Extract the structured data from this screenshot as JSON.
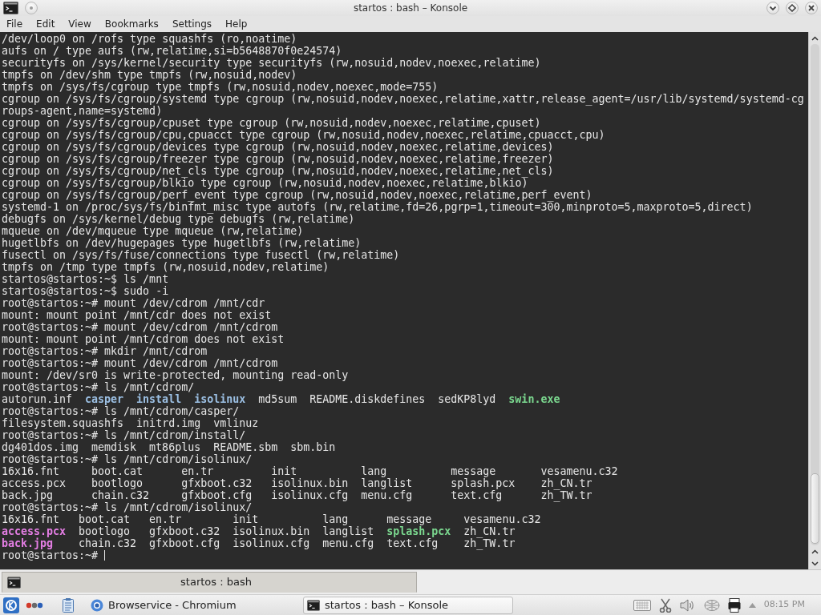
{
  "window": {
    "title": "startos : bash – Konsole"
  },
  "menu": [
    "File",
    "Edit",
    "View",
    "Bookmarks",
    "Settings",
    "Help"
  ],
  "terminal": {
    "lines": [
      {
        "kind": "text",
        "text": "/dev/loop0 on /rofs type squashfs (ro,noatime)"
      },
      {
        "kind": "text",
        "text": "aufs on / type aufs (rw,relatime,si=b5648870f0e24574)"
      },
      {
        "kind": "text",
        "text": "securityfs on /sys/kernel/security type securityfs (rw,nosuid,nodev,noexec,relatime)"
      },
      {
        "kind": "text",
        "text": "tmpfs on /dev/shm type tmpfs (rw,nosuid,nodev)"
      },
      {
        "kind": "text",
        "text": "tmpfs on /sys/fs/cgroup type tmpfs (rw,nosuid,nodev,noexec,mode=755)"
      },
      {
        "kind": "text",
        "text": "cgroup on /sys/fs/cgroup/systemd type cgroup (rw,nosuid,nodev,noexec,relatime,xattr,release_agent=/usr/lib/systemd/systemd-cg"
      },
      {
        "kind": "text",
        "text": "roups-agent,name=systemd)"
      },
      {
        "kind": "text",
        "text": "cgroup on /sys/fs/cgroup/cpuset type cgroup (rw,nosuid,nodev,noexec,relatime,cpuset)"
      },
      {
        "kind": "text",
        "text": "cgroup on /sys/fs/cgroup/cpu,cpuacct type cgroup (rw,nosuid,nodev,noexec,relatime,cpuacct,cpu)"
      },
      {
        "kind": "text",
        "text": "cgroup on /sys/fs/cgroup/devices type cgroup (rw,nosuid,nodev,noexec,relatime,devices)"
      },
      {
        "kind": "text",
        "text": "cgroup on /sys/fs/cgroup/freezer type cgroup (rw,nosuid,nodev,noexec,relatime,freezer)"
      },
      {
        "kind": "text",
        "text": "cgroup on /sys/fs/cgroup/net_cls type cgroup (rw,nosuid,nodev,noexec,relatime,net_cls)"
      },
      {
        "kind": "text",
        "text": "cgroup on /sys/fs/cgroup/blkio type cgroup (rw,nosuid,nodev,noexec,relatime,blkio)"
      },
      {
        "kind": "text",
        "text": "cgroup on /sys/fs/cgroup/perf_event type cgroup (rw,nosuid,nodev,noexec,relatime,perf_event)"
      },
      {
        "kind": "text",
        "text": "systemd-1 on /proc/sys/fs/binfmt_misc type autofs (rw,relatime,fd=26,pgrp=1,timeout=300,minproto=5,maxproto=5,direct)"
      },
      {
        "kind": "text",
        "text": "debugfs on /sys/kernel/debug type debugfs (rw,relatime)"
      },
      {
        "kind": "text",
        "text": "mqueue on /dev/mqueue type mqueue (rw,relatime)"
      },
      {
        "kind": "text",
        "text": "hugetlbfs on /dev/hugepages type hugetlbfs (rw,relatime)"
      },
      {
        "kind": "text",
        "text": "fusectl on /sys/fs/fuse/connections type fusectl (rw,relatime)"
      },
      {
        "kind": "text",
        "text": "tmpfs on /tmp type tmpfs (rw,nosuid,nodev,relatime)"
      },
      {
        "kind": "text",
        "text": "startos@startos:~$ ls /mnt"
      },
      {
        "kind": "text",
        "text": "startos@startos:~$ sudo -i"
      },
      {
        "kind": "text",
        "text": "root@startos:~# mount /dev/cdrom /mnt/cdr"
      },
      {
        "kind": "text",
        "text": "mount: mount point /mnt/cdr does not exist"
      },
      {
        "kind": "text",
        "text": "root@startos:~# mount /dev/cdrom /mnt/cdrom"
      },
      {
        "kind": "text",
        "text": "mount: mount point /mnt/cdrom does not exist"
      },
      {
        "kind": "text",
        "text": "root@startos:~# mkdir /mnt/cdrom"
      },
      {
        "kind": "text",
        "text": "root@startos:~# mount /dev/cdrom /mnt/cdrom"
      },
      {
        "kind": "text",
        "text": "mount: /dev/sr0 is write-protected, mounting read-only"
      },
      {
        "kind": "text",
        "text": "root@startos:~# ls /mnt/cdrom/"
      },
      {
        "kind": "listing",
        "rows": [
          [
            {
              "name": "autorun.inf",
              "color": "#e6e6e6",
              "bold": false
            },
            {
              "name": "casper",
              "color": "#9cc0e4",
              "bold": true
            },
            {
              "name": "install",
              "color": "#9cc0e4",
              "bold": true
            },
            {
              "name": "isolinux",
              "color": "#9cc0e4",
              "bold": true
            },
            {
              "name": "md5sum",
              "color": "#e6e6e6",
              "bold": false
            },
            {
              "name": "README.diskdefines",
              "color": "#e6e6e6",
              "bold": false
            },
            {
              "name": "sedKP8lyd",
              "color": "#e6e6e6",
              "bold": false
            },
            {
              "name": "swin.exe",
              "color": "#7bd88f",
              "bold": true
            }
          ]
        ]
      },
      {
        "kind": "text",
        "text": "root@startos:~# ls /mnt/cdrom/casper/"
      },
      {
        "kind": "listing",
        "rows": [
          [
            {
              "name": "filesystem.squashfs",
              "color": "#e6e6e6",
              "bold": false
            },
            {
              "name": "initrd.img",
              "color": "#e6e6e6",
              "bold": false
            },
            {
              "name": "vmlinuz",
              "color": "#e6e6e6",
              "bold": false
            }
          ]
        ]
      },
      {
        "kind": "text",
        "text": "root@startos:~# ls /mnt/cdrom/install/"
      },
      {
        "kind": "listing",
        "rows": [
          [
            {
              "name": "dg401dos.img",
              "color": "#e6e6e6",
              "bold": false
            },
            {
              "name": "memdisk",
              "color": "#e6e6e6",
              "bold": false
            },
            {
              "name": "mt86plus",
              "color": "#e6e6e6",
              "bold": false
            },
            {
              "name": "README.sbm",
              "color": "#e6e6e6",
              "bold": false
            },
            {
              "name": "sbm.bin",
              "color": "#e6e6e6",
              "bold": false
            }
          ]
        ]
      },
      {
        "kind": "text",
        "text": "root@startos:~# ls /mnt/cdrom/isolinux/"
      },
      {
        "kind": "columns",
        "rows": [
          [
            {
              "name": "16x16.fnt",
              "color": "#e6e6e6",
              "bold": false
            },
            {
              "name": "boot.cat",
              "color": "#e6e6e6",
              "bold": false
            },
            {
              "name": "en.tr",
              "color": "#e6e6e6",
              "bold": false
            },
            {
              "name": "init",
              "color": "#e6e6e6",
              "bold": false
            },
            {
              "name": "lang",
              "color": "#e6e6e6",
              "bold": false
            },
            {
              "name": "message",
              "color": "#e6e6e6",
              "bold": false
            },
            {
              "name": "vesamenu.c32",
              "color": "#e6e6e6",
              "bold": false
            }
          ],
          [
            {
              "name": "access.pcx",
              "color": "#e6e6e6",
              "bold": false
            },
            {
              "name": "bootlogo",
              "color": "#e6e6e6",
              "bold": false
            },
            {
              "name": "gfxboot.c32",
              "color": "#e6e6e6",
              "bold": false
            },
            {
              "name": "isolinux.bin",
              "color": "#e6e6e6",
              "bold": false
            },
            {
              "name": "langlist",
              "color": "#e6e6e6",
              "bold": false
            },
            {
              "name": "splash.pcx",
              "color": "#e6e6e6",
              "bold": false
            },
            {
              "name": "zh_CN.tr",
              "color": "#e6e6e6",
              "bold": false
            }
          ],
          [
            {
              "name": "back.jpg",
              "color": "#e6e6e6",
              "bold": false
            },
            {
              "name": "chain.c32",
              "color": "#e6e6e6",
              "bold": false
            },
            {
              "name": "gfxboot.cfg",
              "color": "#e6e6e6",
              "bold": false
            },
            {
              "name": "isolinux.cfg",
              "color": "#e6e6e6",
              "bold": false
            },
            {
              "name": "menu.cfg",
              "color": "#e6e6e6",
              "bold": false
            },
            {
              "name": "text.cfg",
              "color": "#e6e6e6",
              "bold": false
            },
            {
              "name": "zh_TW.tr",
              "color": "#e6e6e6",
              "bold": false
            }
          ]
        ]
      },
      {
        "kind": "text",
        "text": "root@startos:~# ls /mnt/cdrom/isolinux/"
      },
      {
        "kind": "listing",
        "rows": [
          [
            {
              "name": "16x16.fnt",
              "color": "#e6e6e6",
              "bold": false
            },
            {
              "name": "boot.cat",
              "color": "#e6e6e6",
              "bold": false
            },
            {
              "name": "en.tr",
              "color": "#e6e6e6",
              "bold": false
            },
            {
              "name": "init",
              "color": "#e6e6e6",
              "bold": false
            },
            {
              "name": "lang",
              "color": "#e6e6e6",
              "bold": false
            },
            {
              "name": "message",
              "color": "#e6e6e6",
              "bold": false
            },
            {
              "name": "vesamenu.c32",
              "color": "#e6e6e6",
              "bold": false
            }
          ],
          [
            {
              "name": "access.pcx",
              "color": "#e47ee4",
              "bold": true
            },
            {
              "name": "bootlogo",
              "color": "#e6e6e6",
              "bold": false
            },
            {
              "name": "gfxboot.c32",
              "color": "#e6e6e6",
              "bold": false
            },
            {
              "name": "isolinux.bin",
              "color": "#e6e6e6",
              "bold": false
            },
            {
              "name": "langlist",
              "color": "#e6e6e6",
              "bold": false
            },
            {
              "name": "splash.pcx",
              "color": "#7bd88f",
              "bold": true
            },
            {
              "name": "zh_CN.tr",
              "color": "#e6e6e6",
              "bold": false
            }
          ],
          [
            {
              "name": "back.jpg",
              "color": "#e47ee4",
              "bold": true
            },
            {
              "name": "chain.c32",
              "color": "#e6e6e6",
              "bold": false
            },
            {
              "name": "gfxboot.cfg",
              "color": "#e6e6e6",
              "bold": false
            },
            {
              "name": "isolinux.cfg",
              "color": "#e6e6e6",
              "bold": false
            },
            {
              "name": "menu.cfg",
              "color": "#e6e6e6",
              "bold": false
            },
            {
              "name": "text.cfg",
              "color": "#e6e6e6",
              "bold": false
            },
            {
              "name": "zh_TW.tr",
              "color": "#e6e6e6",
              "bold": false
            }
          ]
        ]
      },
      {
        "kind": "prompt",
        "text": "root@startos:~#"
      }
    ]
  },
  "tabs": [
    {
      "label": "startos : bash",
      "selected": true
    }
  ],
  "taskbar": {
    "tasks": [
      {
        "kind": "browser",
        "label": "Browservice - Chromium",
        "selected": false
      },
      {
        "kind": "terminal",
        "label": "startos : bash – Konsole",
        "selected": true
      }
    ],
    "clock": "08:15 PM"
  }
}
